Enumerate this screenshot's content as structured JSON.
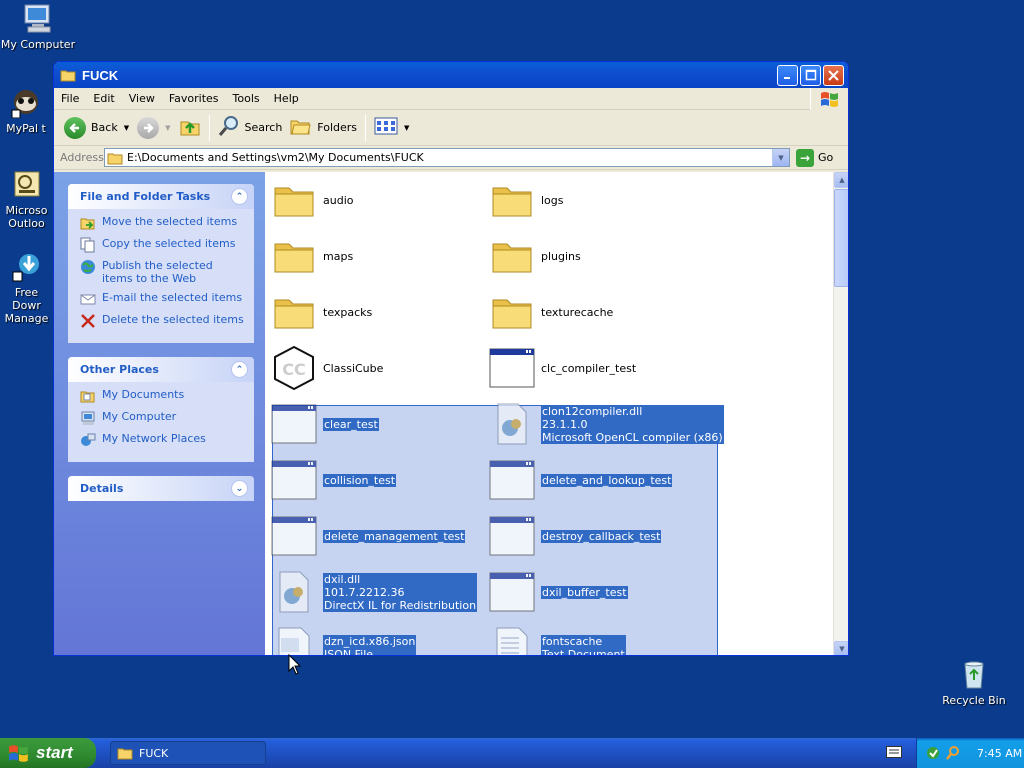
{
  "desktop": {
    "icons": [
      {
        "label": "My Computer"
      },
      {
        "label": "MyPal t"
      },
      {
        "label": "Microso Outloo"
      },
      {
        "label": "Free Dowr Manage"
      },
      {
        "label": "Recycle Bin"
      }
    ]
  },
  "window": {
    "title": "FUCK",
    "menu": [
      "File",
      "Edit",
      "View",
      "Favorites",
      "Tools",
      "Help"
    ],
    "toolbar": {
      "back": "Back",
      "search": "Search",
      "folders": "Folders"
    },
    "address": {
      "label": "Address",
      "path": "E:\\Documents and Settings\\vm2\\My Documents\\FUCK",
      "go": "Go"
    }
  },
  "taskpane": {
    "file_tasks": {
      "title": "File and Folder Tasks",
      "items": [
        "Move the selected items",
        "Copy the selected items",
        "Publish the selected items to the Web",
        "E-mail the selected items",
        "Delete the selected items"
      ]
    },
    "other_places": {
      "title": "Other Places",
      "items": [
        "My Documents",
        "My Computer",
        "My Network Places"
      ]
    },
    "details": {
      "title": "Details"
    }
  },
  "files": [
    {
      "name": "audio",
      "type": "folder",
      "selected": false
    },
    {
      "name": "logs",
      "type": "folder",
      "selected": false
    },
    {
      "name": "maps",
      "type": "folder",
      "selected": false
    },
    {
      "name": "plugins",
      "type": "folder",
      "selected": false
    },
    {
      "name": "texpacks",
      "type": "folder",
      "selected": false
    },
    {
      "name": "texturecache",
      "type": "folder",
      "selected": false
    },
    {
      "name": "ClassiCube",
      "type": "app-cube",
      "selected": false
    },
    {
      "name": "clc_compiler_test",
      "type": "exe",
      "selected": false
    },
    {
      "name": "clear_test",
      "type": "exe",
      "selected": true
    },
    {
      "name": "clon12compiler.dll",
      "line2": "23.1.1.0",
      "line3": "Microsoft OpenCL compiler (x86)",
      "type": "dll",
      "selected": true
    },
    {
      "name": "collision_test",
      "type": "exe",
      "selected": true
    },
    {
      "name": "delete_and_lookup_test",
      "type": "exe",
      "selected": true
    },
    {
      "name": "delete_management_test",
      "type": "exe",
      "selected": true
    },
    {
      "name": "destroy_callback_test",
      "type": "exe",
      "selected": true
    },
    {
      "name": "dxil.dll",
      "line2": "101.7.2212.36",
      "line3": "DirectX IL for Redistribution",
      "type": "dll",
      "selected": true
    },
    {
      "name": "dxil_buffer_test",
      "type": "exe",
      "selected": true
    },
    {
      "name": "dzn_icd.x86.json",
      "line2": "JSON File",
      "type": "json",
      "selected": true
    },
    {
      "name": "fontscache",
      "line2": "Text Document",
      "type": "txt",
      "selected": true
    }
  ],
  "taskbar": {
    "start": "start",
    "open_window": "FUCK",
    "clock": "7:45 AM"
  }
}
